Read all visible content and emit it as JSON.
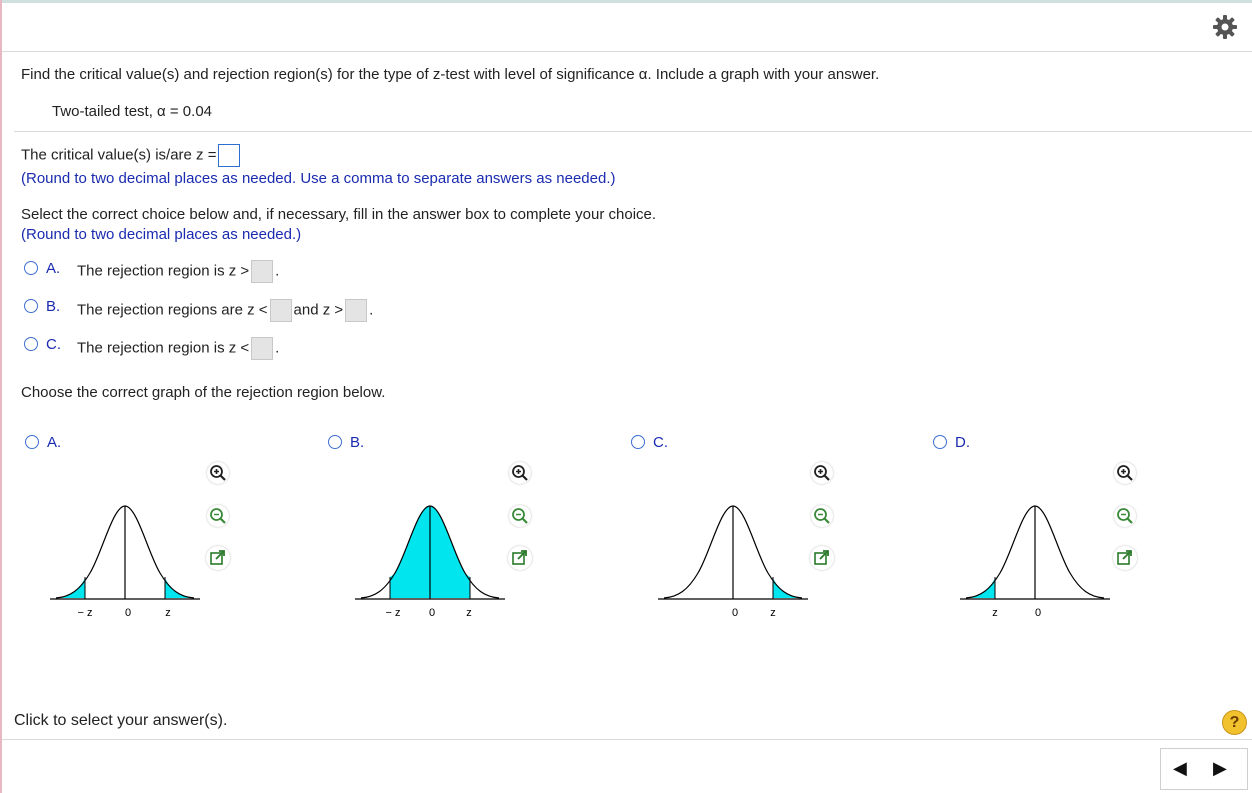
{
  "question": {
    "prompt": "Find the critical value(s) and rejection region(s) for the type of z-test with level of significance α. Include a graph with your answer.",
    "given": "Two-tailed test, α = 0.04"
  },
  "part1": {
    "label": "The critical value(s) is/are z =",
    "hint": "(Round to two decimal places as needed. Use a comma to separate answers as needed.)"
  },
  "part2": {
    "instruction": "Select the correct choice below and, if necessary, fill in the answer box to complete your choice.",
    "hint": "(Round to two decimal places as needed.)",
    "choices": [
      {
        "letter": "A.",
        "pre": "The rejection region is z >",
        "post": "."
      },
      {
        "letter": "B.",
        "pre": "The rejection regions are z <",
        "mid": "and z >",
        "post": "."
      },
      {
        "letter": "C.",
        "pre": "The rejection region is z <",
        "post": "."
      }
    ]
  },
  "part3": {
    "instruction": "Choose the correct graph of the rejection region below.",
    "options": [
      {
        "letter": "A.",
        "tick_labels": [
          "− z",
          "0",
          "z"
        ]
      },
      {
        "letter": "B.",
        "tick_labels": [
          "− z",
          "0",
          "z"
        ]
      },
      {
        "letter": "C.",
        "tick_labels": [
          "0",
          "z"
        ]
      },
      {
        "letter": "D.",
        "tick_labels": [
          "z",
          "0"
        ]
      }
    ]
  },
  "footer": {
    "status": "Click to select your answer(s).",
    "help": "?",
    "prev_glyph": "◀",
    "next_glyph": "▶"
  },
  "colors": {
    "shade": "#00e5ee",
    "link": "#1a2bb0",
    "radio": "#3f6fcf"
  }
}
